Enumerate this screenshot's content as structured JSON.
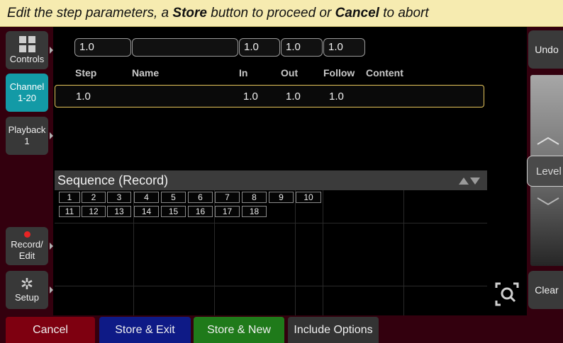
{
  "banner": {
    "t1": "Edit the step parameters, a ",
    "store": "Store",
    "t2": " button to proceed or ",
    "cancel": "Cancel",
    "t3": " to abort"
  },
  "sidebar": {
    "controls": "Controls",
    "channel_1": "Channel",
    "channel_2": "1-20",
    "playback_1": "Playback",
    "playback_2": "1",
    "record_1": "Record/",
    "record_2": "Edit",
    "setup": "Setup"
  },
  "fields": {
    "step": "1.0",
    "name": "",
    "in": "1.0",
    "out": "1.0",
    "follow": "1.0"
  },
  "columns": [
    "Step",
    "Name",
    "In",
    "Out",
    "Follow",
    "Content"
  ],
  "row": {
    "step": "1.0",
    "in": "1.0",
    "out": "1.0",
    "follow": "1.0"
  },
  "sequence": {
    "title": "Sequence (Record)",
    "steps": [
      "1",
      "2",
      "3",
      "4",
      "5",
      "6",
      "7",
      "8",
      "9",
      "10",
      "11",
      "12",
      "13",
      "14",
      "15",
      "16",
      "17",
      "18"
    ]
  },
  "right": {
    "undo": "Undo",
    "level": "Level",
    "clear": "Clear"
  },
  "bottom": {
    "cancel": "Cancel",
    "store_exit": "Store & Exit",
    "store_new": "Store & New",
    "include": "Include Options"
  },
  "colors": {
    "banner_bg": "#f6ebb0",
    "side_bg": "#33000e",
    "active_tab": "#139aa6",
    "cancel_btn": "#7e0010",
    "store_exit_btn": "#0e1a86",
    "store_new_btn": "#1f7a1a",
    "row_border": "#e6c55a"
  },
  "icons": {
    "controls": "grid-icon",
    "record": "record-dot-icon",
    "setup": "gear-icon",
    "magnify": "magnify-icon",
    "sequence_sort": "up-down-arrows-icon"
  }
}
